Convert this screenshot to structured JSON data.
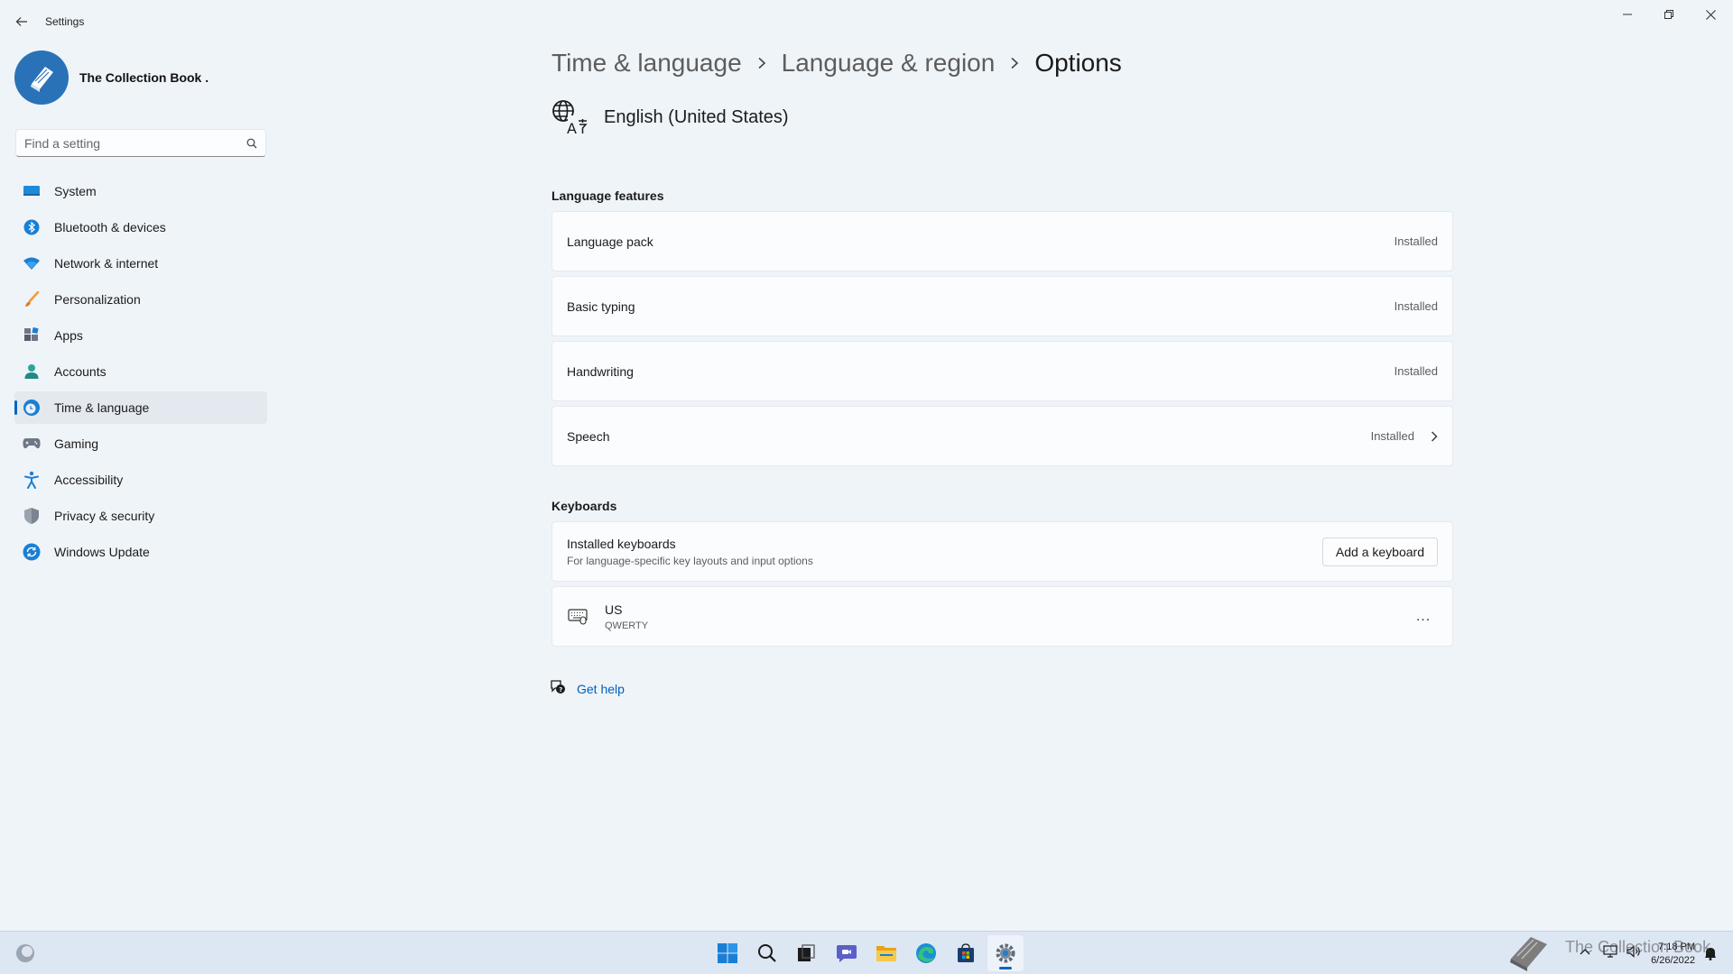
{
  "window": {
    "title": "Settings"
  },
  "profile": {
    "name": "The Collection Book ."
  },
  "search": {
    "placeholder": "Find a setting"
  },
  "nav": {
    "items": [
      {
        "label": "System",
        "icon": "monitor-icon"
      },
      {
        "label": "Bluetooth & devices",
        "icon": "bluetooth-icon"
      },
      {
        "label": "Network & internet",
        "icon": "wifi-icon"
      },
      {
        "label": "Personalization",
        "icon": "brush-icon"
      },
      {
        "label": "Apps",
        "icon": "apps-icon"
      },
      {
        "label": "Accounts",
        "icon": "person-icon"
      },
      {
        "label": "Time & language",
        "icon": "clock-globe-icon",
        "selected": true
      },
      {
        "label": "Gaming",
        "icon": "gamepad-icon"
      },
      {
        "label": "Accessibility",
        "icon": "accessibility-icon"
      },
      {
        "label": "Privacy & security",
        "icon": "shield-icon"
      },
      {
        "label": "Windows Update",
        "icon": "update-icon"
      }
    ]
  },
  "breadcrumb": [
    "Time & language",
    "Language & region",
    "Options"
  ],
  "language": {
    "name": "English (United States)",
    "icon": "language-icon"
  },
  "language_features": {
    "title": "Language features",
    "items": [
      {
        "label": "Language pack",
        "status": "Installed"
      },
      {
        "label": "Basic typing",
        "status": "Installed"
      },
      {
        "label": "Handwriting",
        "status": "Installed"
      },
      {
        "label": "Speech",
        "status": "Installed",
        "has_chevron": true
      }
    ]
  },
  "keyboards": {
    "title": "Keyboards",
    "installed_title": "Installed keyboards",
    "installed_sub": "For language-specific key layouts and input options",
    "add_button": "Add a keyboard",
    "keyboard": {
      "name": "US",
      "layout": "QWERTY",
      "more": "..."
    }
  },
  "help": {
    "label": "Get help"
  },
  "taskbar": {
    "time": "7:18 PM",
    "date": "6/26/2022",
    "apps": [
      "start-icon",
      "search-icon",
      "task-view-icon",
      "chat-icon",
      "file-explorer-icon",
      "edge-icon",
      "store-icon",
      "settings-icon"
    ]
  },
  "watermark": "The Collection Book",
  "colors": {
    "accent": "#0067c0",
    "background": "#eff4f9",
    "card": "#fbfcfe",
    "link": "#005fb8"
  }
}
